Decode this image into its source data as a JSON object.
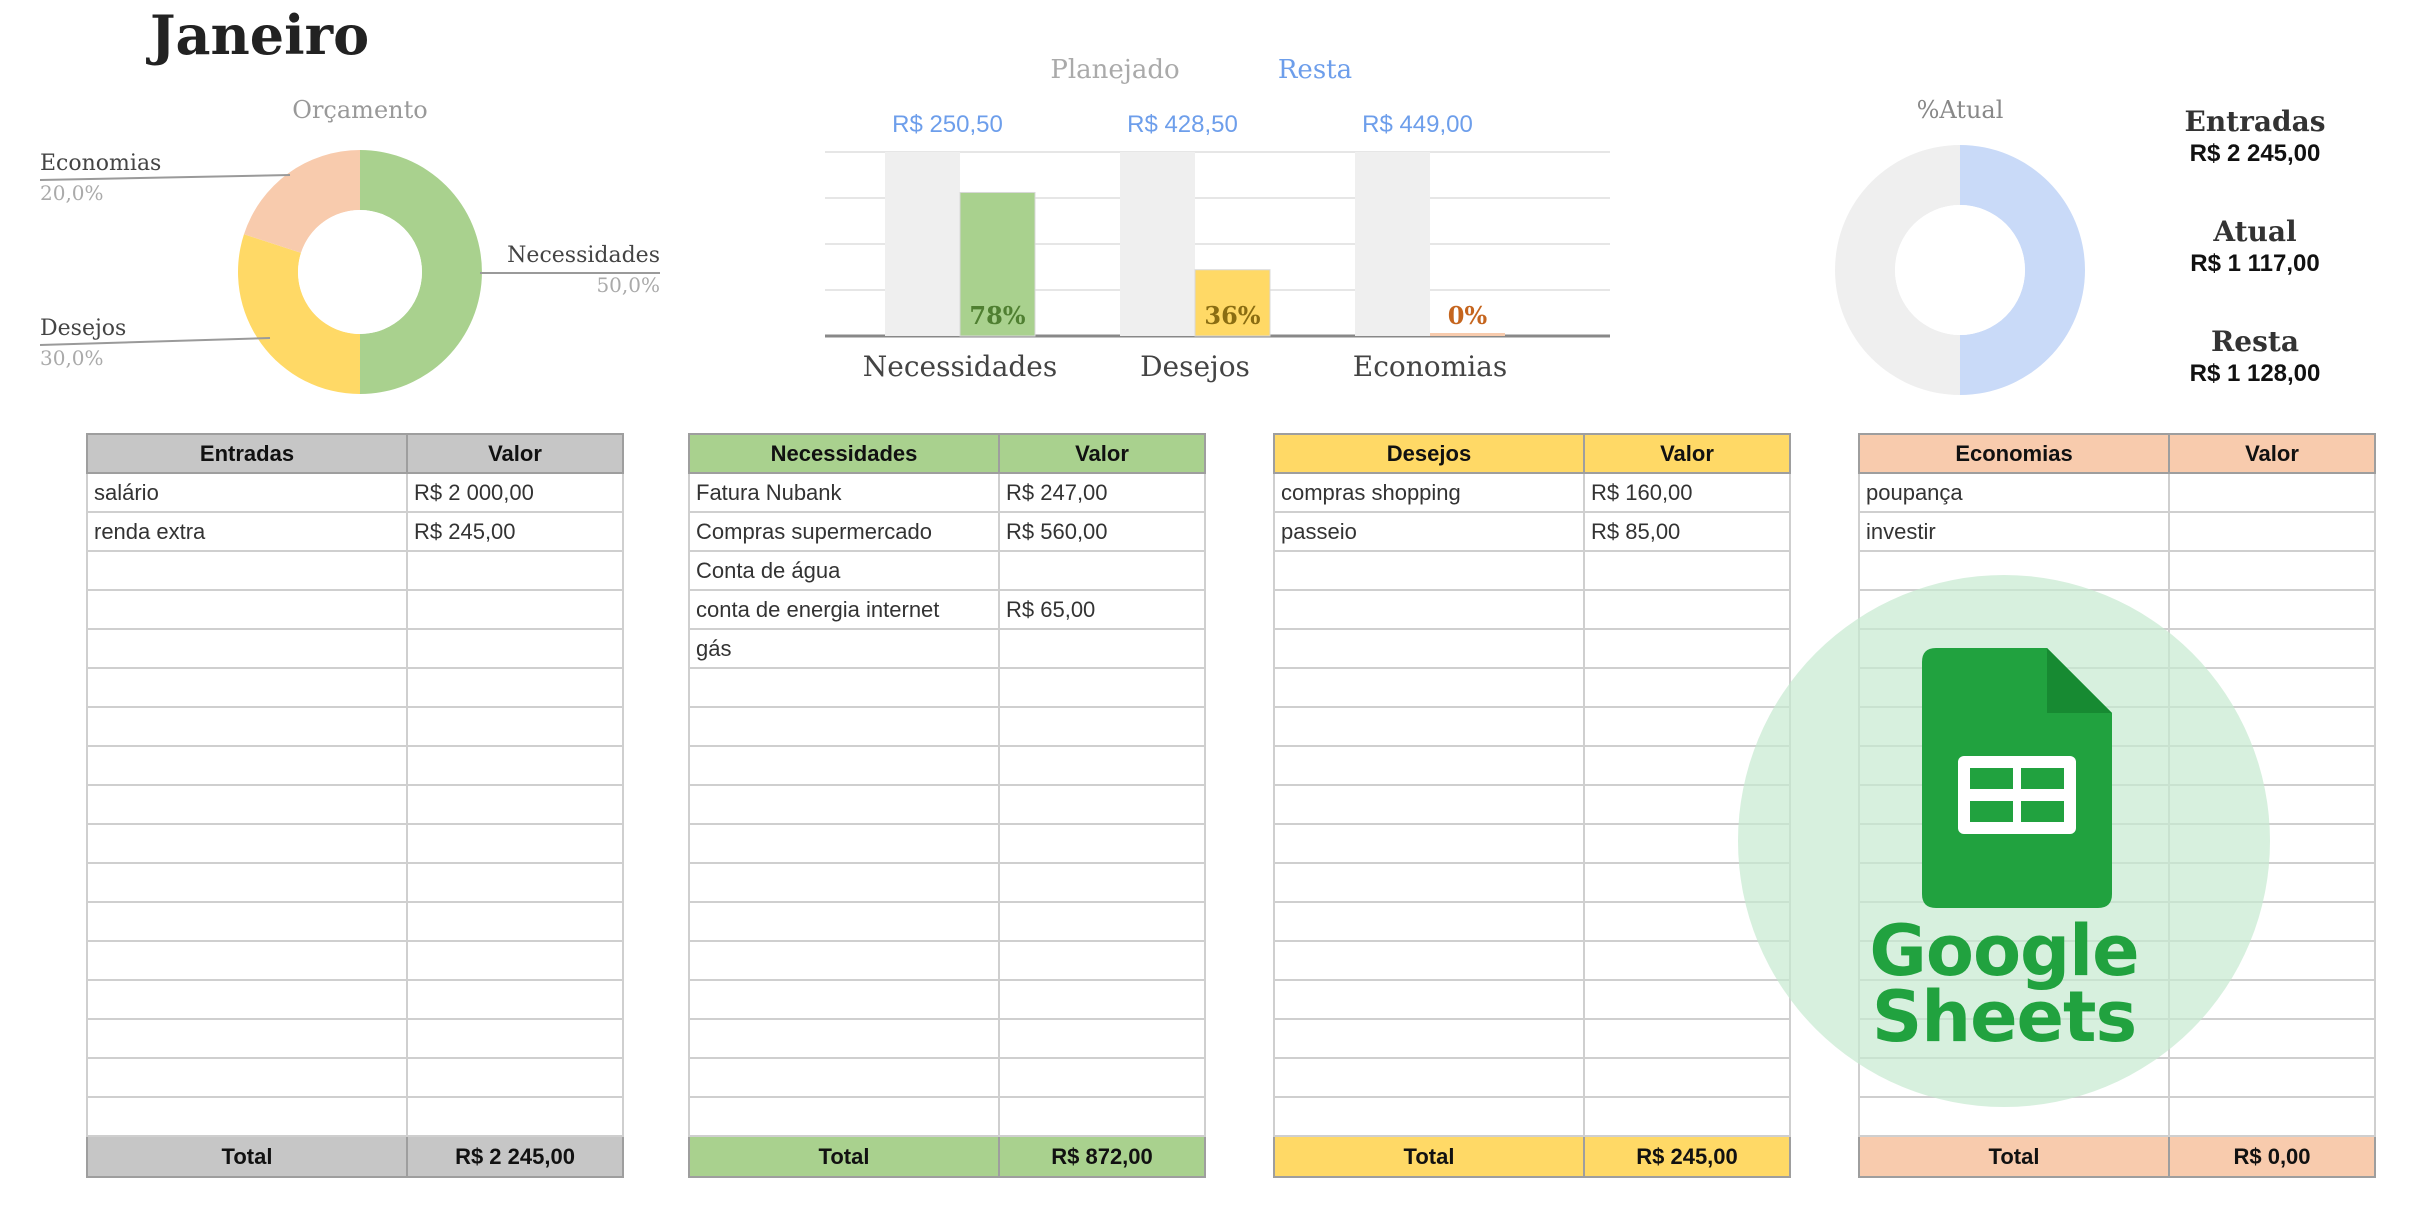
{
  "title": "Janeiro",
  "budget": {
    "title": "Orçamento",
    "slices": [
      {
        "label": "Necessidades",
        "percent": "50,0%",
        "value": 50,
        "color": "#a9d18e"
      },
      {
        "label": "Desejos",
        "percent": "30,0%",
        "value": 30,
        "color": "#ffd966"
      },
      {
        "label": "Economias",
        "percent": "20,0%",
        "value": 20,
        "color": "#f8cbad"
      }
    ]
  },
  "chart_data": [
    {
      "type": "pie",
      "title": "Orçamento",
      "categories": [
        "Necessidades",
        "Desejos",
        "Economias"
      ],
      "values": [
        50,
        30,
        20
      ],
      "labels": [
        "50,0%",
        "30,0%",
        "20,0%"
      ]
    },
    {
      "type": "bar",
      "categories": [
        "Necessidades",
        "Desejos",
        "Economias"
      ],
      "series": [
        {
          "name": "Planejado",
          "values": [
            100,
            100,
            100
          ]
        },
        {
          "name": "Resta",
          "values": [
            78,
            36,
            0
          ]
        }
      ],
      "top_labels": [
        "R$ 250,50",
        "R$ 428,50",
        "R$ 449,00"
      ],
      "bar_labels": [
        "78%",
        "36%",
        "0%"
      ],
      "bar_colors": [
        "#a9d18e",
        "#ffd966",
        "#f8cbad"
      ],
      "planned_color": "#efefef",
      "legend_colors": {
        "Planejado": "#aaaaaa",
        "Resta": "#6d9eeb"
      },
      "ylim": [
        0,
        100
      ],
      "grid": true
    },
    {
      "type": "pie",
      "title": "%Atual",
      "values": [
        50,
        50
      ],
      "colors": [
        "#c9daf8",
        "#efefef"
      ]
    }
  ],
  "actual": {
    "title": "%Atual"
  },
  "summary": {
    "entradas_label": "Entradas",
    "entradas_value": "R$ 2 245,00",
    "atual_label": "Atual",
    "atual_value": "R$ 1 117,00",
    "resta_label": "Resta",
    "resta_value": "R$ 1 128,00"
  },
  "tables": {
    "entradas": {
      "header": [
        "Entradas",
        "Valor"
      ],
      "rows": [
        [
          "salário",
          "R$ 2 000,00"
        ],
        [
          "renda extra",
          "R$ 245,00"
        ]
      ],
      "total_label": "Total",
      "total_value": "R$ 2 245,00"
    },
    "necessidades": {
      "header": [
        "Necessidades",
        "Valor"
      ],
      "rows": [
        [
          "Fatura Nubank",
          "R$ 247,00"
        ],
        [
          "Compras supermercado",
          "R$ 560,00"
        ],
        [
          "Conta de água",
          ""
        ],
        [
          "conta de energia internet",
          "R$ 65,00"
        ],
        [
          "gás",
          ""
        ]
      ],
      "total_label": "Total",
      "total_value": "R$ 872,00"
    },
    "desejos": {
      "header": [
        "Desejos",
        "Valor"
      ],
      "rows": [
        [
          "compras shopping",
          "R$ 160,00"
        ],
        [
          "passeio",
          "R$ 85,00"
        ]
      ],
      "total_label": "Total",
      "total_value": "R$ 245,00"
    },
    "economias": {
      "header": [
        "Economias",
        "Valor"
      ],
      "rows": [
        [
          "poupança",
          ""
        ],
        [
          "investir",
          ""
        ]
      ],
      "total_label": "Total",
      "total_value": "R$ 0,00"
    }
  },
  "watermark": {
    "line1": "Google",
    "line2": "Sheets",
    "color": "#21a23f",
    "icon": "google-sheets-icon"
  }
}
